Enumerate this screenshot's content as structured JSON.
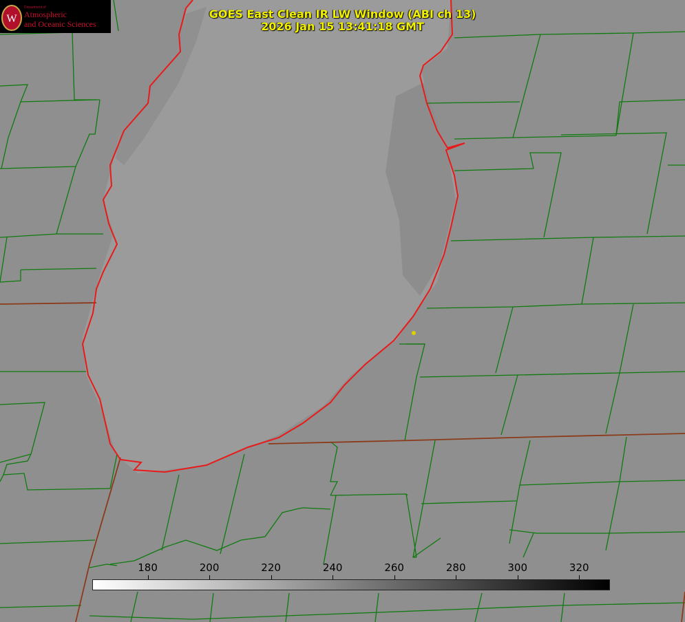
{
  "header": {
    "title_line1": "GOES East Clean IR LW Window (ABI ch 13)",
    "title_line2": "2026 Jan 15 13:41:18 GMT"
  },
  "logo": {
    "department": "Department of",
    "line1": "Atmospheric",
    "line2": "and Oceanic Sciences",
    "letter": "W"
  },
  "colorbar": {
    "ticks": [
      "180",
      "200",
      "220",
      "240",
      "260",
      "280",
      "300",
      "320"
    ],
    "range": [
      162,
      330
    ],
    "low_color": "#ffffff",
    "high_color": "#000000"
  },
  "colors": {
    "title": "#f0f000",
    "state_borders": "#8b3a1a",
    "county_lines": "#0f7a0f",
    "coastline": "#e81a1a",
    "marker": "#e0d000",
    "land": "#8f8f8f",
    "lake": "#9a9a9a"
  }
}
